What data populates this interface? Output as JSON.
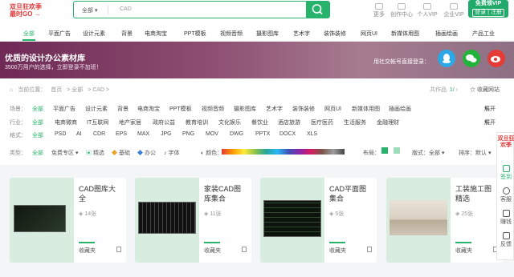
{
  "promo": {
    "line1": "双旦狂欢季",
    "line2": "最时GO →"
  },
  "search": {
    "scope": "全部",
    "query": "CAD"
  },
  "user": {
    "items": [
      "更多",
      "创作中心",
      "个人VIP",
      "企业VIP"
    ],
    "vip_promo": "免费领VIP",
    "login_label": "登录 | 注册"
  },
  "nav": {
    "items": [
      "全部",
      "平面广告",
      "设计元素",
      "背景",
      "电商淘宝",
      "PPT模板",
      "视频音频",
      "摄影图库",
      "艺术字",
      "装饰装修",
      "网页UI",
      "新媒体用图",
      "插画绘画",
      "产品工业"
    ]
  },
  "banner": {
    "title": "优质的设计办公素材库",
    "subtitle": "3500万用户的选择，立即登录不加班！",
    "social_login": "用社交帐号直接登录："
  },
  "breadcrumb": {
    "prefix": "当前位置：",
    "items": [
      "首页",
      "> 全部",
      "> CAD >"
    ]
  },
  "pagination": {
    "label": "共作品",
    "value": "1/"
  },
  "favorite_label": "收藏网站",
  "filters": {
    "scene": {
      "label": "场景：",
      "options": [
        "全部",
        "平面广告",
        "设计元素",
        "背景",
        "电商淘宝",
        "PPT模板",
        "视频音频",
        "摄影图库",
        "艺术字",
        "装饰装修",
        "网页UI",
        "新媒体用图",
        "插画绘画"
      ],
      "expand": "展开"
    },
    "industry": {
      "label": "行业：",
      "options": [
        "全部",
        "电商微商",
        "IT互联网",
        "地产家居",
        "政府公益",
        "教育培训",
        "文化娱乐",
        "餐饮业",
        "酒店旅游",
        "医疗医药",
        "生活服务",
        "金融理财"
      ],
      "expand": "展开"
    },
    "format": {
      "label": "格式：",
      "options": [
        "全部",
        "PSD",
        "AI",
        "CDR",
        "EPS",
        "MAX",
        "JPG",
        "PNG",
        "MOV",
        "DWG",
        "PPTX",
        "DOCX",
        "XLS"
      ]
    }
  },
  "type_bar": {
    "label": "类型：",
    "options": [
      "全部",
      "免费专区",
      "精选",
      "基础",
      "办公",
      "字体"
    ],
    "color_label": "颜色：",
    "layout_label": "布局：",
    "version_label": "版式：全部",
    "sort_label": "排序：默认"
  },
  "cards": [
    {
      "title": "CAD图库大全",
      "count": "14张",
      "fav": "收藏夹"
    },
    {
      "title": "家装CAD图库集合",
      "count": "11张",
      "fav": "收藏夹"
    },
    {
      "title": "CAD平面图集合",
      "count": "5张",
      "fav": "收藏夹"
    },
    {
      "title": "工装施工图精选",
      "count": "25张",
      "fav": "收藏夹"
    }
  ],
  "side_panel": {
    "promo": "双旦狂欢季",
    "items": [
      "签到",
      "客服",
      "赚钱",
      "反馈"
    ]
  },
  "colors": {
    "accent": "#27b36b",
    "promo_red": "#e03b3b",
    "banner_start": "#6e2a55"
  }
}
